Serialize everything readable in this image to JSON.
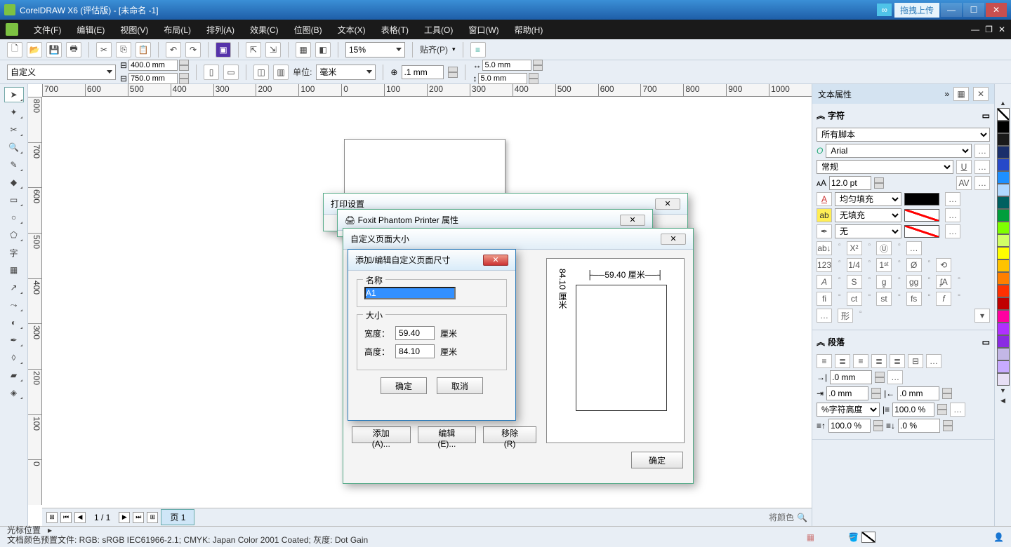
{
  "titlebar": {
    "title": "CorelDRAW X6 (评估版) - [未命名 -1]",
    "drag": "拖拽上传"
  },
  "menu": [
    "文件(F)",
    "编辑(E)",
    "视图(V)",
    "布局(L)",
    "排列(A)",
    "效果(C)",
    "位图(B)",
    "文本(X)",
    "表格(T)",
    "工具(O)",
    "窗口(W)",
    "帮助(H)"
  ],
  "tb1": {
    "zoom": "15%",
    "snap": "贴齐(P)"
  },
  "tb2": {
    "pagesize": "自定义",
    "w": "400.0 mm",
    "h": "750.0 mm",
    "units_lbl": "单位:",
    "units": "毫米",
    "nudge": ".1 mm",
    "dup_x": "5.0 mm",
    "dup_y": "5.0 mm"
  },
  "ruler_h": [
    "700",
    "600",
    "500",
    "400",
    "300",
    "200",
    "100",
    "0",
    "100",
    "200",
    "300",
    "400",
    "500",
    "600",
    "700",
    "800",
    "900",
    "1000"
  ],
  "ruler_v": [
    "800",
    "700",
    "600",
    "500",
    "400",
    "300",
    "200",
    "100",
    "0"
  ],
  "pagenav": {
    "pages": "1 / 1",
    "tab": "页 1"
  },
  "canvas_hint": "将颜色",
  "status": {
    "cursor": "光标位置",
    "profile": "文档颜色预置文件: RGB: sRGB IEC61966-2.1; CMYK: Japan Color 2001 Coated; 灰度: Dot Gain"
  },
  "rpanel": {
    "title": "文本属性",
    "sec_char": "字符",
    "script": "所有脚本",
    "font": "Arial",
    "style": "常规",
    "size": "12.0 pt",
    "fill_lbl": "均匀填充",
    "bgfill_lbl": "无填充",
    "outline_lbl": "无",
    "sec_para": "段落",
    "indent1": ".0 mm",
    "indent2": ".0 mm",
    "indent3": ".0 mm",
    "lh_mode": "%字符高度",
    "lh1": "100.0 %",
    "lh2": "100.0 %",
    "lh3": ".0 %"
  },
  "palette": [
    "#ffffff",
    "#000000",
    "#222222",
    "#1a2f6b",
    "#2649c9",
    "#1e90ff",
    "#b0d8ff",
    "#006060",
    "#009e3c",
    "#7fff00",
    "#d1ff66",
    "#ffff00",
    "#ffc300",
    "#ff7f00",
    "#ff3000",
    "#c00000",
    "#ff00a0",
    "#b030ff",
    "#8a2be2",
    "#c3b7e6",
    "#c7aaff",
    "#e7dff5"
  ],
  "dlg_print": {
    "title": "打印设置"
  },
  "dlg_props": {
    "title": "Foxit Phantom Printer 属性"
  },
  "dlg_custom": {
    "title": "自定义页面大小",
    "add": "添加(A)...",
    "edit": "编辑(E)...",
    "remove": "移除(R)",
    "ok": "确定",
    "dim_w": "59.40 厘米",
    "dim_h": "84.10 厘米"
  },
  "dlg_addedit": {
    "title": "添加/编辑自定义页面尺寸",
    "name_lbl": "名称",
    "name_val": "A1",
    "size_lbl": "大小",
    "w_lbl": "宽度：",
    "w_val": "59.40",
    "w_unit": "厘米",
    "h_lbl": "高度：",
    "h_val": "84.10",
    "h_unit": "厘米",
    "ok": "确定",
    "cancel": "取消"
  }
}
